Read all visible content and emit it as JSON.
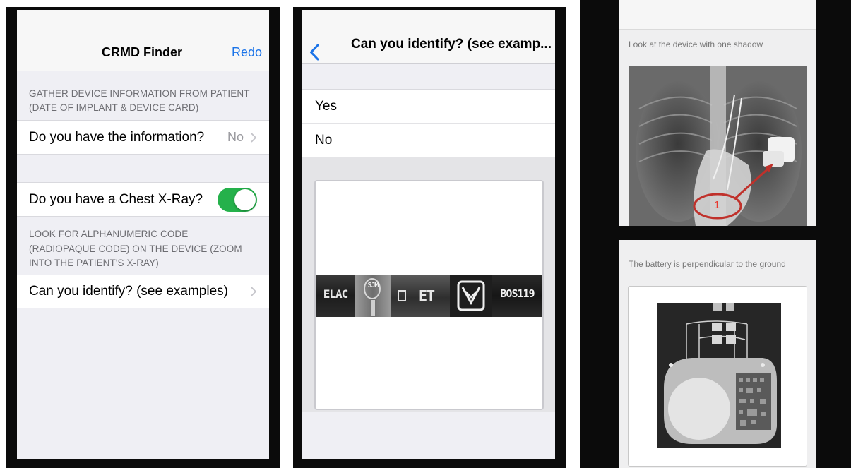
{
  "screen1": {
    "title": "CRMD Finder",
    "action": "Redo",
    "header1": "GATHER DEVICE INFORMATION FROM PATIENT (DATE OF IMPLANT & DEVICE CARD)",
    "row_info_label": "Do you have the information?",
    "row_info_value": "No",
    "row_xray_label": "Do you have a Chest X-Ray?",
    "row_xray_on": true,
    "header2": "LOOK FOR ALPHANUMERIC CODE (RADIOPAQUE CODE) ON THE DEVICE (ZOOM INTO THE PATIENT'S X-RAY)",
    "row_identify_label": "Can you identify? (see examples)"
  },
  "screen2": {
    "title": "Can you identify? (see examp...",
    "options": [
      "Yes",
      "No"
    ],
    "codes": [
      "ELAC",
      "SJM",
      "ET",
      "BOS119"
    ]
  },
  "panel_top": {
    "caption": "Look at the device with one shadow",
    "marker": "1"
  },
  "panel_bottom": {
    "caption": "The battery is perpendicular to the ground"
  },
  "colors": {
    "ios_blue": "#1a73e8",
    "toggle_green": "#25b14b",
    "annotation_red": "#c0312b"
  }
}
